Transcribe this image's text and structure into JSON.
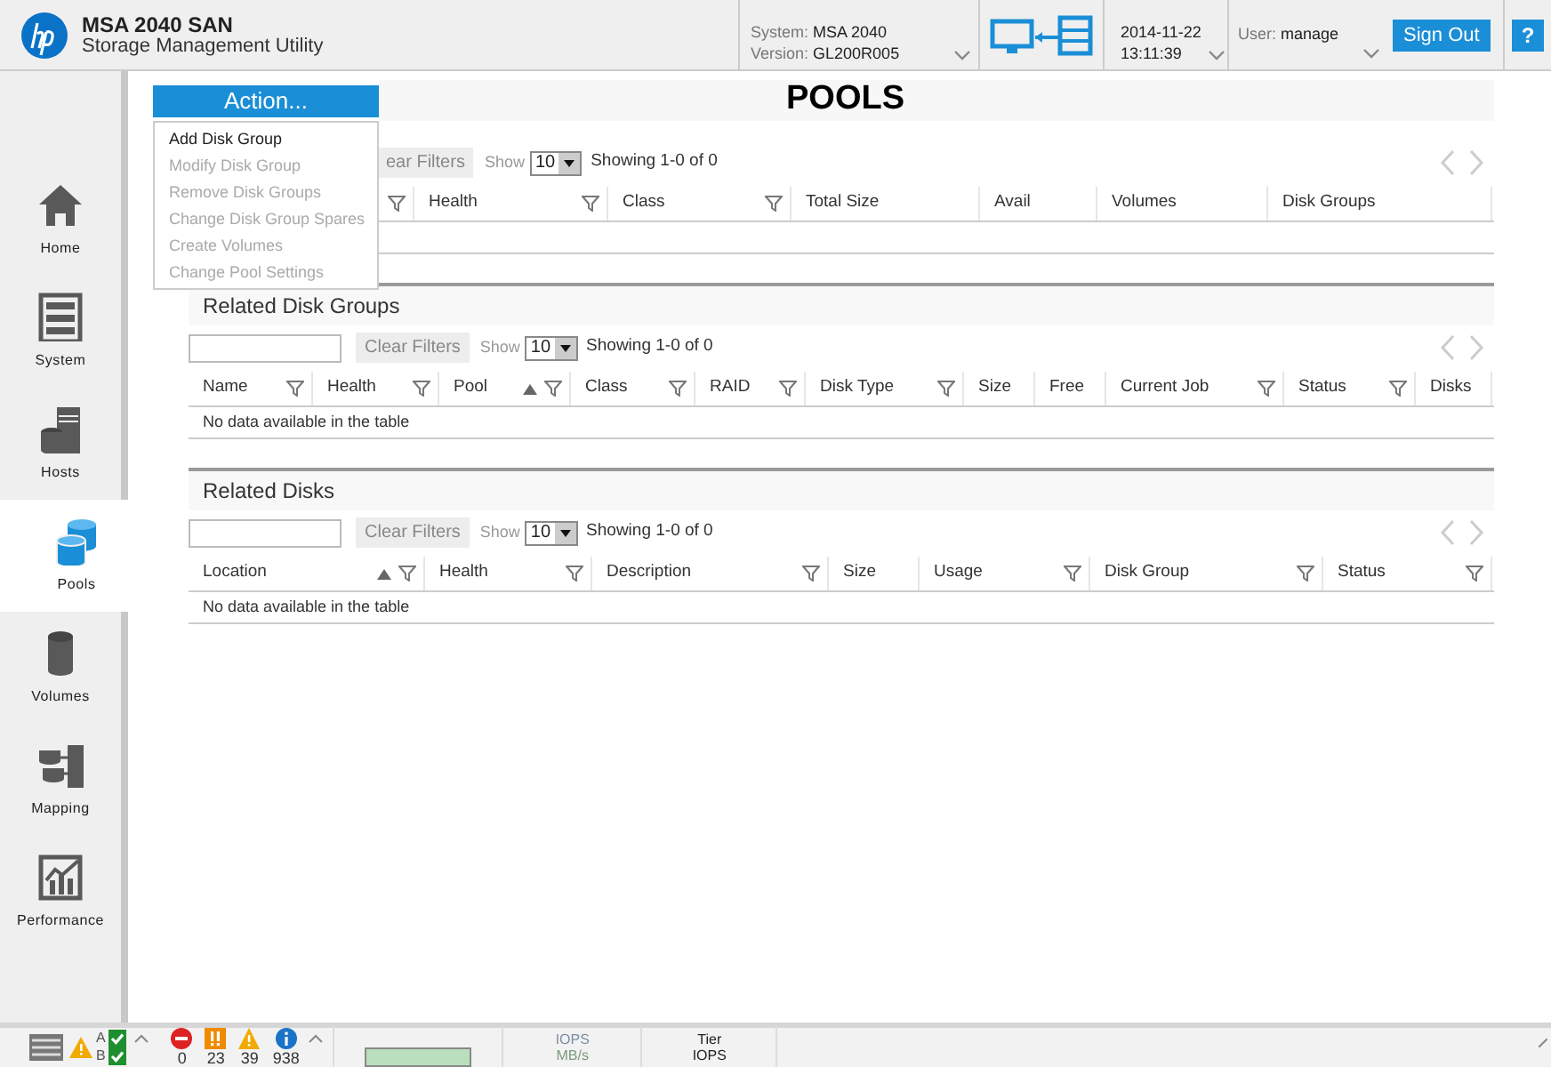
{
  "header": {
    "product": "MSA 2040 SAN",
    "subtitle": "Storage Management Utility",
    "system_label": "System:",
    "system": "MSA 2040",
    "version_label": "Version:",
    "version": "GL200R005",
    "date": "2014-11-22",
    "time": "13:11:39",
    "user_label": "User:",
    "user": "manage",
    "sign_out": "Sign Out",
    "help": "?"
  },
  "sidebar": {
    "items": [
      {
        "label": "Home",
        "selected": false
      },
      {
        "label": "System",
        "selected": false
      },
      {
        "label": "Hosts",
        "selected": false
      },
      {
        "label": "Pools",
        "selected": true
      },
      {
        "label": "Volumes",
        "selected": false
      },
      {
        "label": "Mapping",
        "selected": false
      },
      {
        "label": "Performance",
        "selected": false
      }
    ]
  },
  "page_title": "POOLS",
  "action": {
    "label": "Action...",
    "expanded": true,
    "items": [
      {
        "label": "Add Disk Group",
        "disabled": false
      },
      {
        "label": "Modify Disk Group",
        "disabled": true
      },
      {
        "label": "Remove Disk Groups",
        "disabled": true
      },
      {
        "label": "Change Disk Group Spares",
        "disabled": true
      },
      {
        "label": "Create Volumes",
        "disabled": true
      },
      {
        "label": "Change Pool Settings",
        "disabled": true
      }
    ]
  },
  "tables": [
    {
      "controls": {
        "filter_field": false,
        "clear_filters": "ear Filters",
        "show_label": "Show",
        "page_size": "10",
        "showing": "Showing 1-0 of 0"
      },
      "columns": [
        {
          "filter": true,
          "sorted": false
        },
        {
          "label": "Health",
          "filter": true,
          "sorted": false
        },
        {
          "label": "Class",
          "filter": true,
          "sorted": false
        },
        {
          "label": "Total Size",
          "filter": false,
          "sorted": false
        },
        {
          "label": "Avail",
          "filter": false,
          "sorted": false
        },
        {
          "label": "Volumes",
          "filter": false,
          "sorted": false
        },
        {
          "label": "Disk Groups",
          "filter": false,
          "sorted": false
        }
      ]
    },
    {
      "title": "Related Disk Groups",
      "controls": {
        "filter_field": true,
        "clear_filters": "Clear Filters",
        "show_label": "Show",
        "page_size": "10",
        "showing": "Showing 1-0 of 0"
      },
      "columns": [
        {
          "label": "Name",
          "filter": true,
          "sorted": false
        },
        {
          "label": "Health",
          "filter": true,
          "sorted": false
        },
        {
          "label": "Pool",
          "filter": true,
          "sorted": true
        },
        {
          "label": "Class",
          "filter": true,
          "sorted": false
        },
        {
          "label": "RAID",
          "filter": true,
          "sorted": false
        },
        {
          "label": "Disk Type",
          "filter": true,
          "sorted": false
        },
        {
          "label": "Size",
          "filter": false,
          "sorted": false
        },
        {
          "label": "Free",
          "filter": false,
          "sorted": false
        },
        {
          "label": "Current Job",
          "filter": true,
          "sorted": false
        },
        {
          "label": "Status",
          "filter": true,
          "sorted": false
        },
        {
          "label": "Disks",
          "filter": false,
          "sorted": false
        }
      ],
      "empty_message": "No data available in the table"
    },
    {
      "title": "Related Disks",
      "controls": {
        "filter_field": true,
        "clear_filters": "Clear Filters",
        "show_label": "Show",
        "page_size": "10",
        "showing": "Showing 1-0 of 0"
      },
      "columns": [
        {
          "label": "Location",
          "filter": true,
          "sorted": true
        },
        {
          "label": "Health",
          "filter": true,
          "sorted": false
        },
        {
          "label": "Description",
          "filter": true,
          "sorted": false
        },
        {
          "label": "Size",
          "filter": false,
          "sorted": false
        },
        {
          "label": "Usage",
          "filter": true,
          "sorted": false
        },
        {
          "label": "Disk Group",
          "filter": true,
          "sorted": false
        },
        {
          "label": "Status",
          "filter": true,
          "sorted": false
        }
      ],
      "empty_message": "No data available in the table"
    }
  ],
  "footer": {
    "controllers": [
      {
        "label": "A",
        "ok": true
      },
      {
        "label": "B",
        "ok": true
      }
    ],
    "counts": [
      {
        "kind": "error",
        "value": "0"
      },
      {
        "kind": "critical",
        "value": "23"
      },
      {
        "kind": "warning",
        "value": "39"
      },
      {
        "kind": "info",
        "value": "938"
      }
    ],
    "iops_label": "IOPS",
    "mbs_label": "MB/s",
    "tier_label": "Tier",
    "tier_iops_label": "IOPS"
  }
}
